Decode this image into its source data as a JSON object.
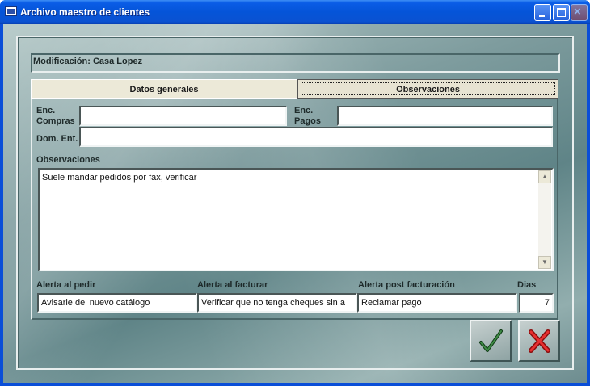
{
  "window": {
    "title": "Archivo maestro de clientes"
  },
  "header": {
    "modification_label": "Modificación: Casa Lopez"
  },
  "tabs": [
    {
      "label": "Datos generales",
      "active": false
    },
    {
      "label": "Observaciones",
      "active": true
    }
  ],
  "form": {
    "enc_compras_label": "Enc.\nCompras",
    "enc_compras_line1": "Enc.",
    "enc_compras_line2": "Compras",
    "enc_compras_value": "",
    "enc_pagos_line1": "Enc.",
    "enc_pagos_line2": "Pagos",
    "enc_pagos_value": "",
    "dom_ent_label": "Dom. Ent.",
    "dom_ent_value": "",
    "observaciones_label": "Observaciones",
    "observaciones_value": "Suele mandar pedidos por fax, verificar",
    "alerta_pedir_label": "Alerta al pedir",
    "alerta_pedir_value": "Avisarle del nuevo catálogo",
    "alerta_facturar_label": "Alerta al facturar",
    "alerta_facturar_value": "Verificar que no tenga cheques sin a",
    "alerta_post_label": "Alerta post facturación",
    "alerta_post_value": "Reclamar pago",
    "dias_label": "Dias",
    "dias_value": "7"
  },
  "icons": {
    "ok": "checkmark-icon",
    "cancel": "red-x-icon",
    "minimize": "minimize-icon",
    "maximize": "maximize-icon",
    "close": "close-icon"
  },
  "colors": {
    "titlebar": "#0554d8",
    "ok_check": "#1c5a22",
    "cancel_x": "#d81e1e"
  }
}
